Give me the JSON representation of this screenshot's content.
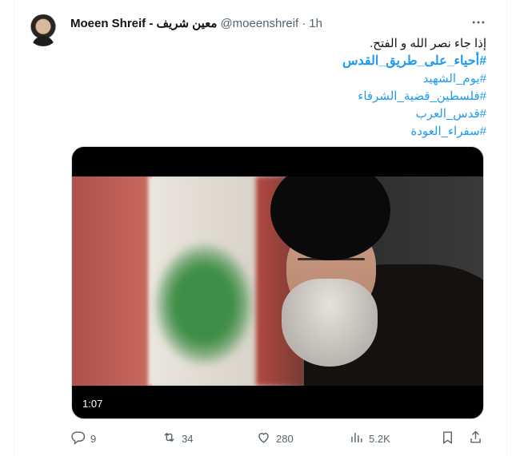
{
  "tweet": {
    "author_name": "Moeen Shreif - معين شريف",
    "handle": "@moeenshreif",
    "separator": "·",
    "time": "1h",
    "text_line1": "إذا جاء نصر الله و الفتح.",
    "hashtags": [
      "#أحياء_على_طريق_القدس",
      "#يوم_الشهيد",
      "#فلسطين_قضية_الشرفاء",
      "#قدس_العرب",
      "#سفراء_العودة"
    ]
  },
  "media": {
    "duration": "1:07"
  },
  "actions": {
    "replies": "9",
    "retweets": "34",
    "likes": "280",
    "views": "5.2K"
  },
  "icons": {
    "more": "more-icon",
    "reply": "reply-icon",
    "retweet": "retweet-icon",
    "like": "heart-icon",
    "views": "views-icon",
    "bookmark": "bookmark-icon",
    "share": "share-icon"
  },
  "colors": {
    "accent": "#1d9bf0",
    "secondary_text": "#536471"
  }
}
